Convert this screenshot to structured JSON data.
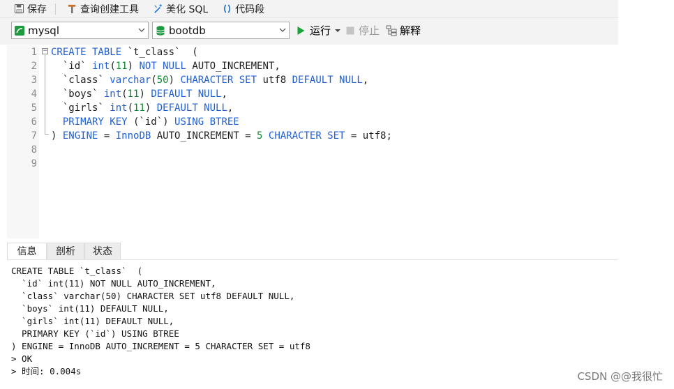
{
  "toolbar": {
    "save_label": "保存",
    "query_builder_label": "查询创建工具",
    "beautify_label": "美化 SQL",
    "snippet_label": "代码段"
  },
  "connection": {
    "selected": "mysql",
    "database": "bootdb",
    "run_label": "运行",
    "stop_label": "停止",
    "explain_label": "解释"
  },
  "editor": {
    "line_numbers": [
      "1",
      "2",
      "3",
      "4",
      "5",
      "6",
      "7",
      "8",
      "9"
    ],
    "lines": [
      [
        {
          "t": "CREATE TABLE ",
          "c": "kw"
        },
        {
          "t": "`t_class`  (",
          "c": ""
        }
      ],
      [
        {
          "t": "  `id` ",
          "c": ""
        },
        {
          "t": "int",
          "c": "kw"
        },
        {
          "t": "(",
          "c": ""
        },
        {
          "t": "11",
          "c": "num"
        },
        {
          "t": ") ",
          "c": ""
        },
        {
          "t": "NOT NULL",
          "c": "kw"
        },
        {
          "t": " AUTO_INCREMENT,",
          "c": ""
        }
      ],
      [
        {
          "t": "  `class` ",
          "c": ""
        },
        {
          "t": "varchar",
          "c": "kw"
        },
        {
          "t": "(",
          "c": ""
        },
        {
          "t": "50",
          "c": "num"
        },
        {
          "t": ") ",
          "c": ""
        },
        {
          "t": "CHARACTER SET",
          "c": "kw"
        },
        {
          "t": " utf8 ",
          "c": ""
        },
        {
          "t": "DEFAULT NULL",
          "c": "kw"
        },
        {
          "t": ",",
          "c": ""
        }
      ],
      [
        {
          "t": "  `boys` ",
          "c": ""
        },
        {
          "t": "int",
          "c": "kw"
        },
        {
          "t": "(",
          "c": ""
        },
        {
          "t": "11",
          "c": "num"
        },
        {
          "t": ") ",
          "c": ""
        },
        {
          "t": "DEFAULT NULL",
          "c": "kw"
        },
        {
          "t": ",",
          "c": ""
        }
      ],
      [
        {
          "t": "  `girls` ",
          "c": ""
        },
        {
          "t": "int",
          "c": "kw"
        },
        {
          "t": "(",
          "c": ""
        },
        {
          "t": "11",
          "c": "num"
        },
        {
          "t": ") ",
          "c": ""
        },
        {
          "t": "DEFAULT NULL",
          "c": "kw"
        },
        {
          "t": ",",
          "c": ""
        }
      ],
      [
        {
          "t": "  PRIMARY KEY",
          "c": "kw"
        },
        {
          "t": " (`id`) ",
          "c": ""
        },
        {
          "t": "USING BTREE",
          "c": "kw"
        }
      ],
      [
        {
          "t": ") ",
          "c": ""
        },
        {
          "t": "ENGINE",
          "c": "kw"
        },
        {
          "t": " = ",
          "c": ""
        },
        {
          "t": "InnoDB",
          "c": "kw"
        },
        {
          "t": " AUTO_INCREMENT = ",
          "c": ""
        },
        {
          "t": "5",
          "c": "num"
        },
        {
          "t": " ",
          "c": ""
        },
        {
          "t": "CHARACTER SET",
          "c": "kw"
        },
        {
          "t": " = utf8;",
          "c": ""
        }
      ],
      [],
      []
    ]
  },
  "tabs": [
    {
      "label": "信息"
    },
    {
      "label": "剖析"
    },
    {
      "label": "状态"
    }
  ],
  "output": {
    "lines": [
      "CREATE TABLE `t_class`  (",
      "  `id` int(11) NOT NULL AUTO_INCREMENT,",
      "  `class` varchar(50) CHARACTER SET utf8 DEFAULT NULL,",
      "  `boys` int(11) DEFAULT NULL,",
      "  `girls` int(11) DEFAULT NULL,",
      "  PRIMARY KEY (`id`) USING BTREE",
      ") ENGINE = InnoDB AUTO_INCREMENT = 5 CHARACTER SET = utf8",
      "> OK",
      "> 时间: 0.004s"
    ]
  },
  "watermark": "CSDN @@我很忙",
  "colors": {
    "keyword": "#1f5fd6",
    "number": "#0c8a2d",
    "run_green": "#1aa33a",
    "db_green": "#1d9a3f"
  }
}
